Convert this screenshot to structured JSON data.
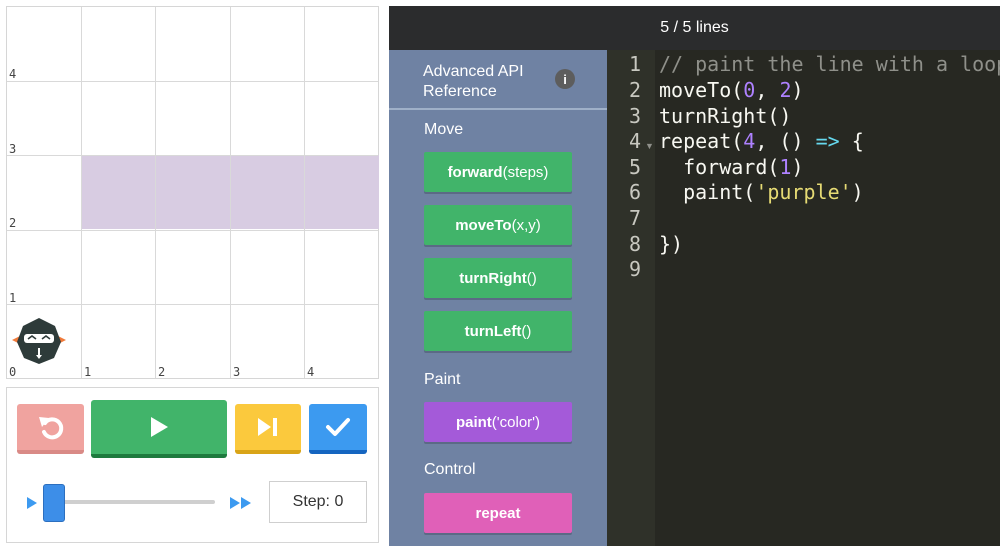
{
  "grid": {
    "x_labels": [
      "0",
      "1",
      "2",
      "3",
      "4"
    ],
    "y_labels": [
      "1",
      "2",
      "3",
      "4"
    ],
    "painted_color": "#d8cce2",
    "painted_row": 2,
    "painted_cols": [
      1,
      2,
      3,
      4
    ]
  },
  "robot": {
    "icon": "robot-icon"
  },
  "controls": {
    "reset": {
      "icon": "undo-icon",
      "color": "#f0a39f"
    },
    "run": {
      "icon": "play-icon",
      "color": "#41b46a"
    },
    "step": {
      "icon": "step-forward-icon",
      "color": "#fbc93d"
    },
    "check": {
      "icon": "checkmark-icon",
      "color": "#3c9af0"
    },
    "speed": {
      "slow_icon": "slow-triangle-icon",
      "fast_icon": "fast-forward-icon",
      "value": 0.05
    },
    "step_label": "Step: 0"
  },
  "editor": {
    "line_count": "5 / 5 lines",
    "api_reference": "Advanced API Reference",
    "info_icon": "i",
    "categories": [
      {
        "label": "Move"
      },
      {
        "label": "Paint"
      },
      {
        "label": "Control"
      }
    ],
    "blocks": {
      "forward": {
        "name": "forward",
        "args": "(steps)"
      },
      "moveTo": {
        "name": "moveTo",
        "args": "(x,y)"
      },
      "turnRight": {
        "name": "turnRight",
        "args": "()"
      },
      "turnLeft": {
        "name": "turnLeft",
        "args": "()"
      },
      "paint": {
        "name": "paint",
        "args": "('color')"
      },
      "repeat": {
        "name": "repeat",
        "args": ""
      }
    },
    "line_numbers": [
      "1",
      "2",
      "3",
      "4",
      "5",
      "6",
      "7",
      "8",
      "9"
    ],
    "code": {
      "l1": "// paint the line with a loop",
      "l2_a": "moveTo(",
      "l2_n1": "0",
      "l2_b": ", ",
      "l2_n2": "2",
      "l2_c": ")",
      "l3": "turnRight()",
      "l4_a": "repeat(",
      "l4_n": "4",
      "l4_b": ", () ",
      "l4_arrow": "=>",
      "l4_c": " {",
      "l5_a": "  forward(",
      "l5_n": "1",
      "l5_b": ")",
      "l6_a": "  paint(",
      "l6_s": "'purple'",
      "l6_b": ")",
      "l7": "",
      "l8": "})",
      "l9": ""
    }
  }
}
